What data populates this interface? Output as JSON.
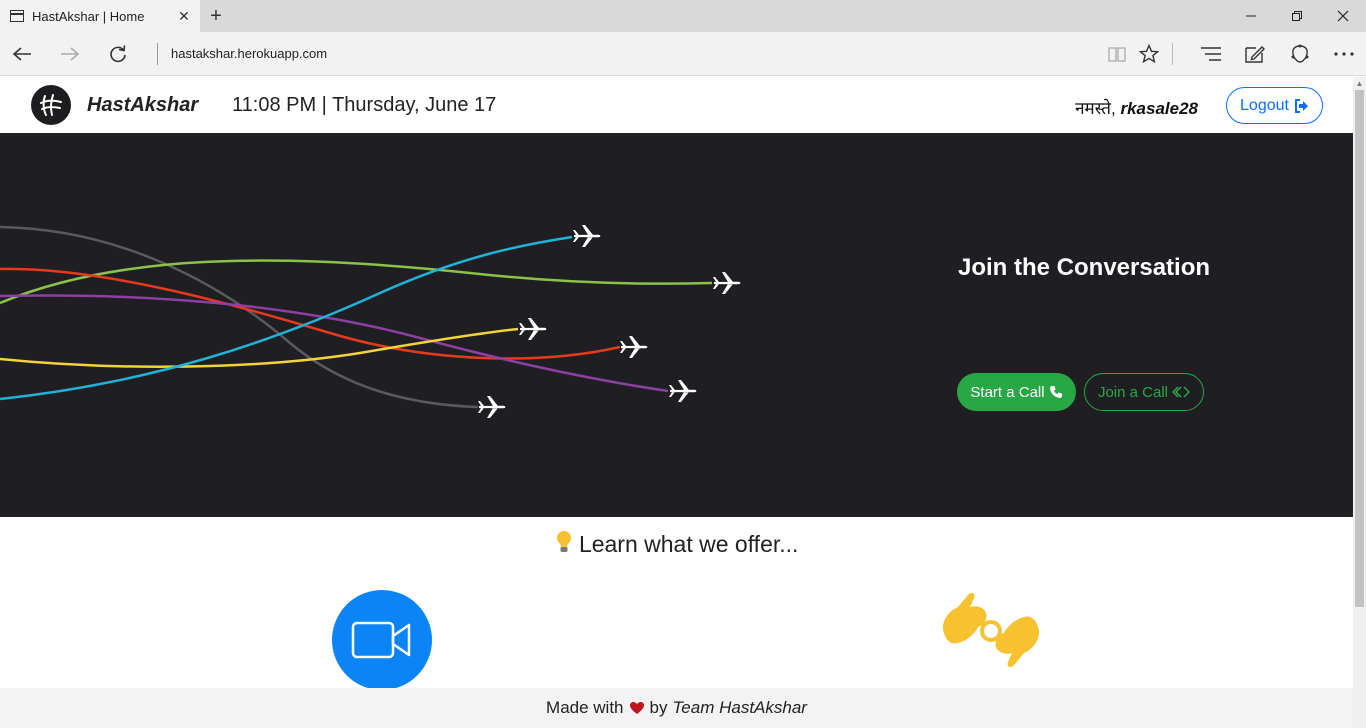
{
  "browser": {
    "tab_title": "HastAkshar | Home",
    "url": "hastakshar.herokuapp.com"
  },
  "navbar": {
    "brand": "HastAkshar",
    "datetime": "11:08 PM | Thursday, June 17",
    "greeting": "नमस्ते,",
    "username": "rkasale28",
    "logout_label": "Logout"
  },
  "hero": {
    "title": "Join the Conversation",
    "start_call_label": "Start a Call",
    "join_call_label": "Join a Call",
    "trail_colors": [
      "#5a5a5e",
      "#8bc34a",
      "#e53a1c",
      "#8e3fa3",
      "#f0d43a",
      "#1fb3d8"
    ]
  },
  "offers": {
    "title": "Learn what we offer...",
    "features": [
      {
        "icon": "video-camera-icon",
        "color": "#0b84f5"
      },
      {
        "icon": "sign-language-hands-icon",
        "color": "#f7c12f"
      }
    ]
  },
  "footer": {
    "made_with": "Made with",
    "by": "by",
    "team": "Team HastAkshar"
  }
}
